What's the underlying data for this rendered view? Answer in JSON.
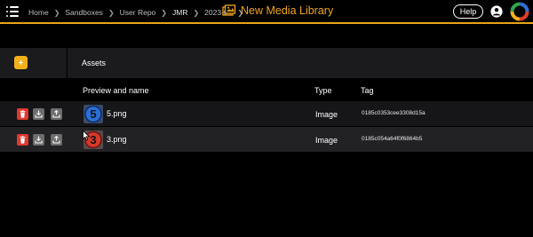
{
  "header": {
    "breadcrumbs": [
      "Home",
      "Sandboxes",
      "User Repo",
      "JMR",
      "2023-01"
    ],
    "title": "New Media Library",
    "help_label": "Help"
  },
  "toolbar": {
    "section_label": "Assets"
  },
  "table": {
    "columns": [
      "Preview and name",
      "Type",
      "Tag"
    ],
    "rows": [
      {
        "name": "5.png",
        "type": "Image",
        "tag": "0185c0353cee3308d15a",
        "thumb_digit": "5",
        "thumb_color": "#2a6fd6"
      },
      {
        "name": "3.png",
        "type": "Image",
        "tag": "0185c054a64f0f6864b5",
        "thumb_digit": "3",
        "thumb_color": "#d8392b"
      }
    ]
  },
  "colors": {
    "accent": "#f0a51b",
    "delete": "#e0382f",
    "action_gray": "#6d6d6d"
  }
}
